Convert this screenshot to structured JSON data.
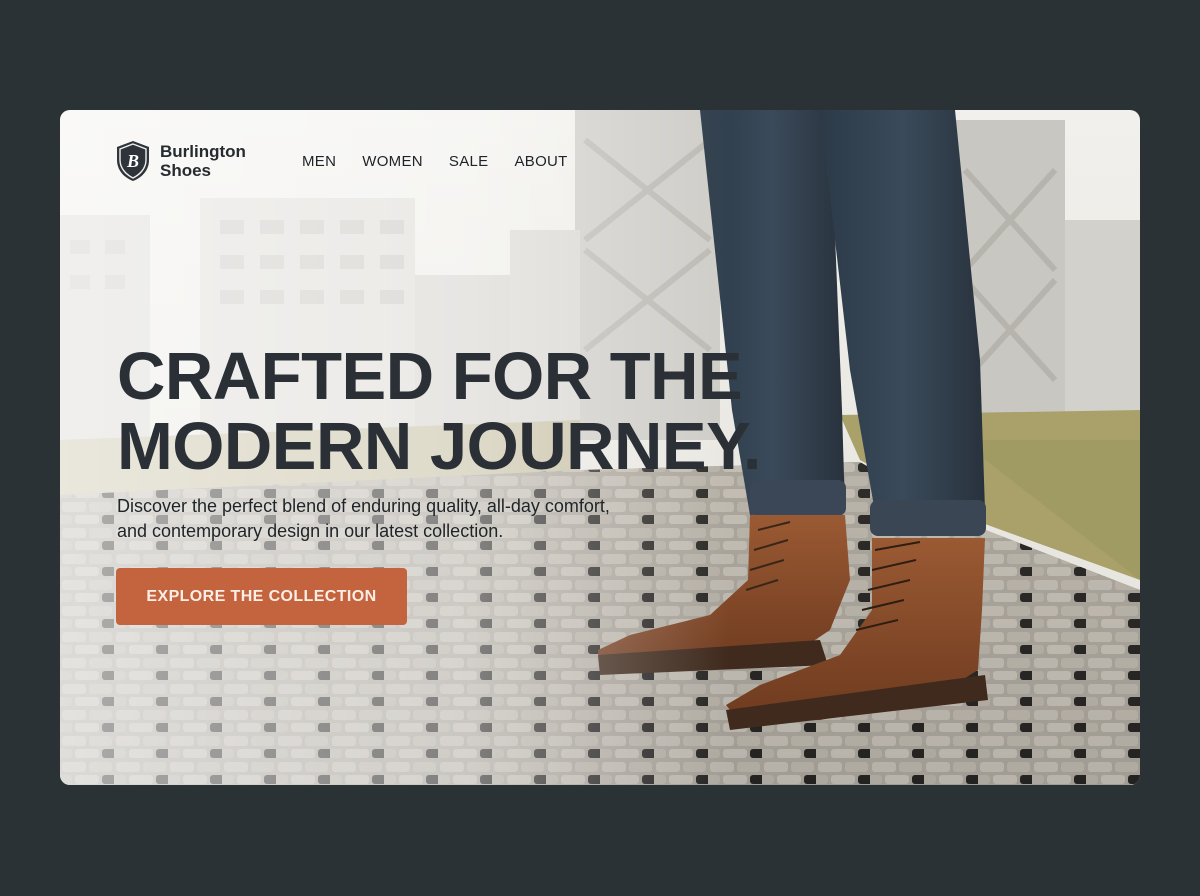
{
  "brand": {
    "name_line1": "Burlington",
    "name_line2": "Shoes",
    "logo_letter": "B"
  },
  "nav": {
    "items": [
      {
        "label": "MEN"
      },
      {
        "label": "WOMEN"
      },
      {
        "label": "SALE"
      },
      {
        "label": "ABOUT"
      }
    ]
  },
  "hero": {
    "headline_line1": "CRAFTED FOR THE",
    "headline_line2": "MODERN JOURNEY.",
    "subtext_line1": "Discover the perfect blend of enduring quality, all-day comfort,",
    "subtext_line2": "and contemporary design in our latest collection.",
    "cta_label": "EXPLORE THE COLLECTION"
  },
  "colors": {
    "page_background": "#2b3235",
    "accent": "#c4643e",
    "text_dark": "#2a3036"
  },
  "icons": {
    "logo": "shield-icon"
  }
}
